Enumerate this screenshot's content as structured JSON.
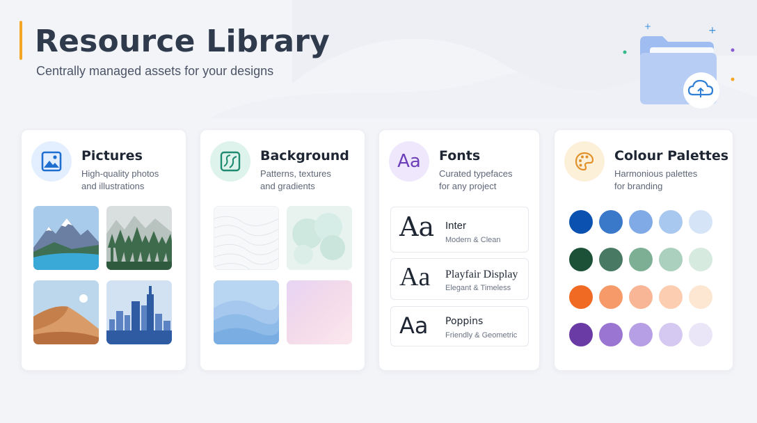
{
  "header": {
    "title": "Resource Library",
    "subtitle": "Centrally managed assets for your designs"
  },
  "colors": {
    "accent": "#f5a524"
  },
  "cards": {
    "pictures": {
      "title": "Pictures",
      "desc_line1": "High-quality photos",
      "desc_line2": "and illustrations",
      "icon": "image-icon",
      "thumbnails": [
        "mountain-lake",
        "forest",
        "desert-dunes",
        "city-skyline"
      ]
    },
    "background": {
      "title": "Background",
      "desc_line1": "Patterns, textures",
      "desc_line2": "and gradients",
      "icon": "background-pattern-icon",
      "thumbnails": [
        "topographic-pattern",
        "watercolor-texture",
        "blue-waves",
        "pastel-gradient"
      ]
    },
    "fonts": {
      "title": "Fonts",
      "desc_line1": "Curated typefaces",
      "desc_line2": "for any project",
      "icon_text": "Aa",
      "items": [
        {
          "sample": "Aa",
          "name": "Inter",
          "note": "Modern & Clean"
        },
        {
          "sample": "Aa",
          "name": "Playfair Display",
          "note": "Elegant & Timeless"
        },
        {
          "sample": "Aa",
          "name": "Poppins",
          "note": "Friendly & Geometric"
        }
      ]
    },
    "palettes": {
      "title": "Colour Palettes",
      "desc_line1": "Harmonious palettes",
      "desc_line2": "for branding",
      "icon": "palette-icon",
      "rows": [
        [
          "#0b52b0",
          "#3a78c9",
          "#7faae6",
          "#a9c8ef",
          "#d5e4f6"
        ],
        [
          "#1c5138",
          "#487a63",
          "#7daf94",
          "#abd0bd",
          "#d7eadf"
        ],
        [
          "#f06a24",
          "#f79a69",
          "#f9b697",
          "#fccdb0",
          "#fde7d2"
        ],
        [
          "#6a3ba5",
          "#9a75d2",
          "#b79fe5",
          "#d5c9f1",
          "#ebe5f8"
        ]
      ]
    }
  }
}
